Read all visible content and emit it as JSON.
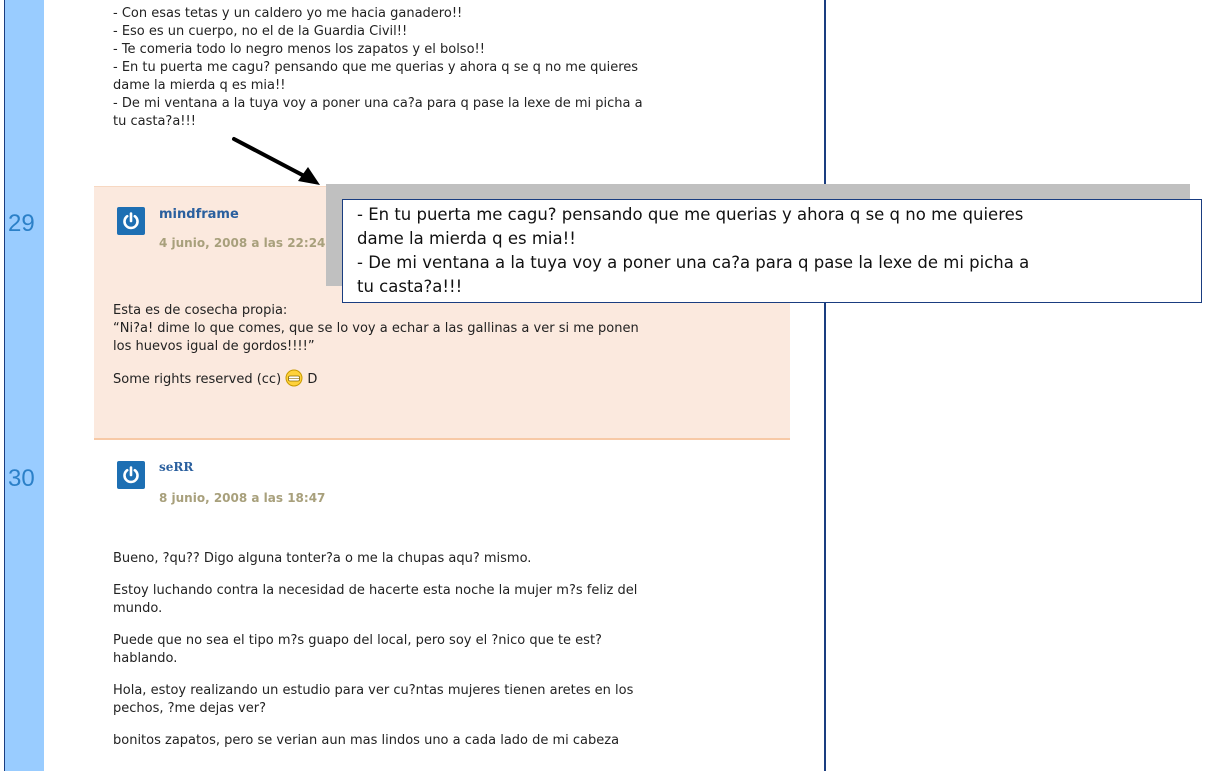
{
  "top_comment": {
    "lines": [
      "- Con esas tetas y un caldero yo me hacia ganadero!!",
      "- Eso es un cuerpo, no el de la Guardia Civil!!",
      "- Te comeria todo lo negro menos los zapatos y el bolso!!",
      "- En tu puerta me cagu? pensando que me querias y ahora q se q no me quieres",
      "dame la mierda q es mia!!",
      "- De mi ventana a la tuya voy a poner una ca?a para q pase la lexe de mi picha a",
      "tu casta?a!!!"
    ]
  },
  "comments": [
    {
      "number": "29",
      "author": "mindframe",
      "date": "4 junio, 2008 a las 22:24",
      "intro": "Esta es de cosecha propia:",
      "body_lines": [
        "“Ni?a! dime lo que comes, que se lo voy a echar a las gallinas a ver si me ponen",
        "los huevos igual de gordos!!!!”"
      ],
      "footer_prefix": "Some rights reserved (cc)",
      "footer_suffix": "D"
    },
    {
      "number": "30",
      "author": "seRR",
      "date": "8 junio, 2008 a las 18:47",
      "paragraphs": [
        [
          "Bueno, ?qu?? Digo alguna tonter?a o me la chupas aqu? mismo."
        ],
        [
          "Estoy luchando contra la necesidad de hacerte esta noche la mujer m?s feliz del",
          "mundo."
        ],
        [
          "Puede que no sea el tipo m?s guapo del local, pero soy el ?nico que te est?",
          "hablando."
        ],
        [
          "Hola, estoy realizando un estudio para ver cu?ntas mujeres tienen aretes en los",
          "pechos, ?me dejas ver?"
        ],
        [
          "bonitos zapatos, pero se verian aun mas lindos uno a cada lado de mi cabeza"
        ]
      ]
    }
  ],
  "zoom_callout": {
    "lines": [
      "- En tu puerta me cagu? pensando que me querias y ahora q se q no me quieres",
      "dame la mierda q es mia!!",
      "- De mi ventana a la tuya voy a poner una ca?a para q pase la lexe de mi picha a",
      "tu casta?a!!!"
    ]
  },
  "icons": {
    "avatar": "power-icon",
    "emoticon": "grinning-emoticon",
    "annotation": "arrow-icon"
  },
  "colors": {
    "strip": "#99ccff",
    "border": "#1a3d80",
    "comment_highlight": "#fbe9de",
    "number": "#2b80c8",
    "author": "#2a5f9e",
    "date": "#a8a07c"
  }
}
